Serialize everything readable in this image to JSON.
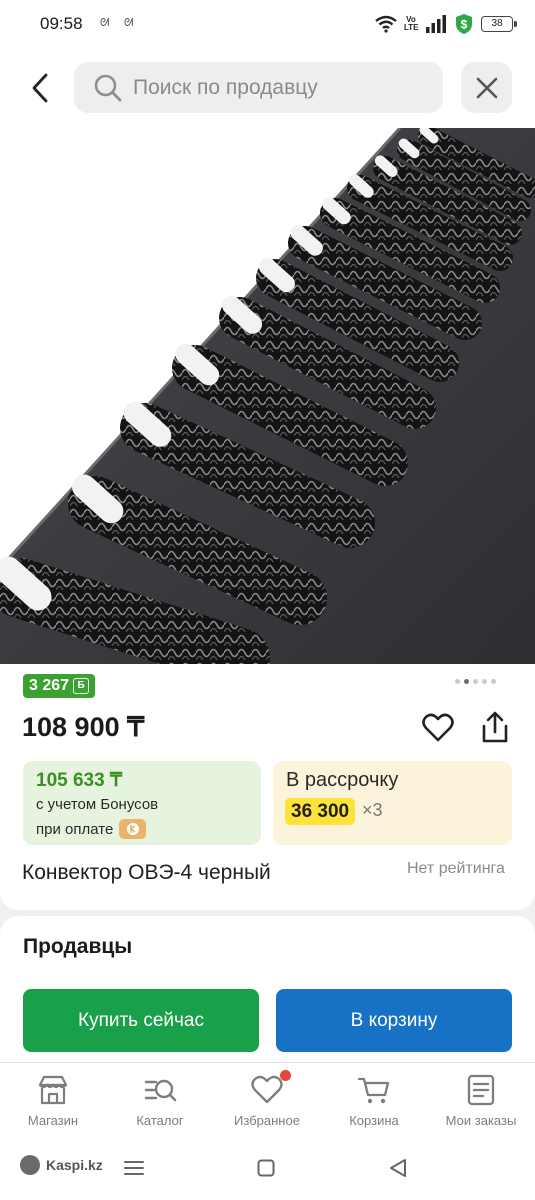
{
  "status_bar": {
    "time": "09:58",
    "notifications": [
      "ᘛ",
      "ᘛ"
    ],
    "network": "Vo LTE",
    "battery": "38"
  },
  "search": {
    "placeholder": "Поиск по продавцу",
    "value": ""
  },
  "product": {
    "bonus_badge": "3 267",
    "bonus_currency": "Б",
    "price": "108 900 ₸",
    "bonus_price": "105 633 ₸",
    "bonus_note_line1": "с учетом Бонусов",
    "bonus_note_line2": "при оплате",
    "installment_title": "В рассрочку",
    "installment_amount": "36 300",
    "installment_months": "×3",
    "title": "Конвектор ОВЭ-4 черный",
    "rating": "Нет рейтинга",
    "image_count": 5,
    "active_image": 2
  },
  "sellers": {
    "heading": "Продавцы",
    "buy_now": "Купить сейчас",
    "add_to_cart": "В корзину"
  },
  "bottom_nav": {
    "items": [
      {
        "label": "Магазин",
        "icon": "shop-icon"
      },
      {
        "label": "Каталог",
        "icon": "catalog-search-icon"
      },
      {
        "label": "Избранное",
        "icon": "heart-icon"
      },
      {
        "label": "Корзина",
        "icon": "cart-icon"
      },
      {
        "label": "Мои заказы",
        "icon": "orders-icon"
      }
    ]
  },
  "system_bar": {
    "watermark": "Kaspi.kz"
  },
  "colors": {
    "green": "#19a04a",
    "blue": "#1772c6",
    "bonus_green": "#3ba22f",
    "installment_yellow": "#fde23a",
    "badge_red": "#e8453c"
  }
}
